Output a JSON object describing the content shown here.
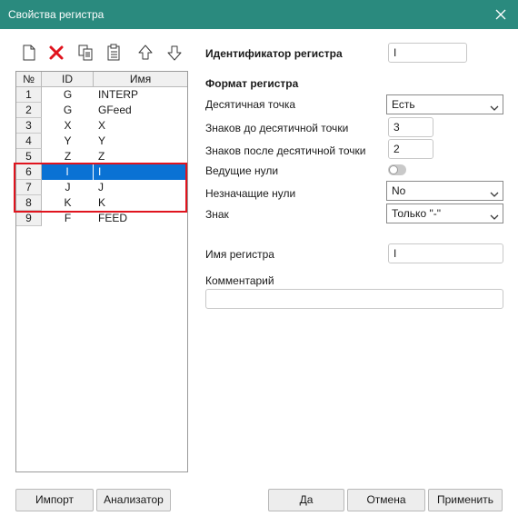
{
  "window": {
    "title": "Свойства регистра"
  },
  "toolbar": {
    "icons": [
      "new-icon",
      "delete-icon",
      "copy-icon",
      "paste-icon",
      "arrow-up-icon",
      "arrow-down-icon"
    ]
  },
  "grid": {
    "columns": [
      "№",
      "ID",
      "Имя"
    ],
    "rows": [
      {
        "num": "1",
        "id": "G",
        "name": "INTERP"
      },
      {
        "num": "2",
        "id": "G",
        "name": "GFeed"
      },
      {
        "num": "3",
        "id": "X",
        "name": "X"
      },
      {
        "num": "4",
        "id": "Y",
        "name": "Y"
      },
      {
        "num": "5",
        "id": "Z",
        "name": "Z"
      },
      {
        "num": "6",
        "id": "I",
        "name": "I",
        "selected": true
      },
      {
        "num": "7",
        "id": "J",
        "name": "J"
      },
      {
        "num": "8",
        "id": "K",
        "name": "K"
      },
      {
        "num": "9",
        "id": "F",
        "name": "FEED"
      }
    ]
  },
  "form": {
    "id_label": "Идентификатор регистра",
    "id_value": "I",
    "format_heading": "Формат регистра",
    "decimal_point_label": "Десятичная точка",
    "decimal_point_value": "Есть",
    "digits_before_label": "Знаков до десятичной точки",
    "digits_before_value": "3",
    "digits_after_label": "Знаков после десятичной точки",
    "digits_after_value": "2",
    "leading_zeros_label": "Ведущие нули",
    "leading_zeros_on": false,
    "trailing_zeros_label": "Незначащие нули",
    "trailing_zeros_value": "No",
    "sign_label": "Знак",
    "sign_value": "Только \"-\"",
    "name_label": "Имя регистра",
    "name_value": "I",
    "comment_label": "Комментарий",
    "comment_value": ""
  },
  "buttons": {
    "import": "Импорт",
    "analyzer": "Анализатор",
    "ok": "Да",
    "cancel": "Отмена",
    "apply": "Применить"
  },
  "colors": {
    "titlebar": "#2a8a7e",
    "selection": "#0a72d4",
    "highlight": "#e0141e",
    "delete": "#e0141e"
  }
}
